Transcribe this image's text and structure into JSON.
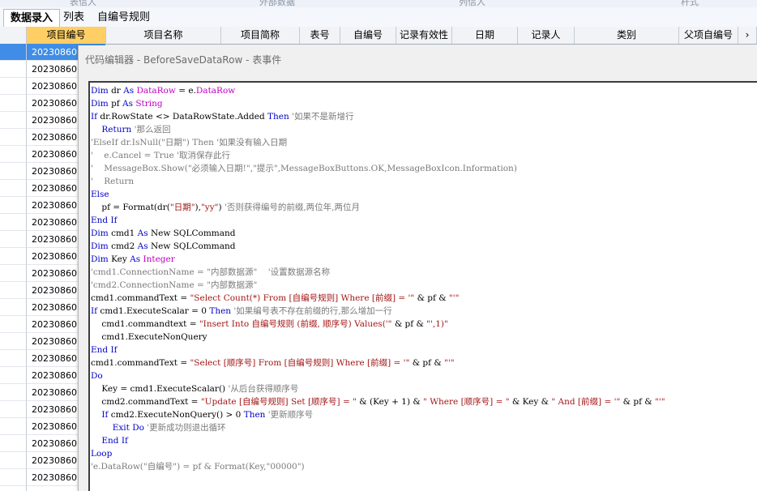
{
  "tabs": [
    {
      "label": "数据录入",
      "active": true
    },
    {
      "label": "列表",
      "active": false
    },
    {
      "label": "自编号规则",
      "active": false
    }
  ],
  "grid": {
    "columns": [
      "项目编号",
      "项目名称",
      "项目简称",
      "表号",
      "自编号",
      "记录有效性",
      "日期",
      "记录人",
      "类别",
      "父项自编号",
      "›"
    ],
    "selected_column": 0,
    "rows": [
      "20230860",
      "20230860",
      "20230860",
      "20230860",
      "20230860",
      "20230860",
      "20230860",
      "20230860",
      "20230860",
      "20230860",
      "20230860",
      "20230860",
      "20230860",
      "20230860",
      "20230860",
      "20230860",
      "20230860",
      "20230860",
      "20230860",
      "20230860",
      "20230860",
      "20230860",
      "20230860",
      "20230860",
      "20230860",
      "20230860",
      "20230860"
    ],
    "current_row": 0
  },
  "editor": {
    "title": "代码编辑器 - BeforeSaveDataRow - 表事件",
    "lines": [
      [
        [
          "kw",
          "Dim"
        ],
        [
          "t",
          " dr "
        ],
        [
          "kw",
          "As"
        ],
        [
          "t",
          " "
        ],
        [
          "cls",
          "DataRow"
        ],
        [
          "t",
          " = e."
        ],
        [
          "cls",
          "DataRow"
        ]
      ],
      [
        [
          "kw",
          "Dim"
        ],
        [
          "t",
          " pf "
        ],
        [
          "kw",
          "As"
        ],
        [
          "t",
          " "
        ],
        [
          "cls",
          "String"
        ]
      ],
      [
        [
          "kw",
          "If"
        ],
        [
          "t",
          " dr.RowState <> DataRowState.Added "
        ],
        [
          "kw",
          "Then"
        ],
        [
          "cm",
          " '如果不是新增行"
        ]
      ],
      [
        [
          "t",
          "    "
        ],
        [
          "kw",
          "Return"
        ],
        [
          "cm",
          " '那么返回"
        ]
      ],
      [
        [
          "cm",
          "'ElseIf dr.IsNull(\"日期\") Then '如果没有输入日期"
        ]
      ],
      [
        [
          "cm",
          "'    e.Cancel = True '取消保存此行"
        ]
      ],
      [
        [
          "cm",
          "'    MessageBox.Show(\"必须输入日期!\",\"提示\",MessageBoxButtons.OK,MessageBoxIcon.Information)"
        ]
      ],
      [
        [
          "cm",
          "'    Return"
        ]
      ],
      [
        [
          "kw",
          "Else"
        ]
      ],
      [
        [
          "t",
          "    pf = Format(dr("
        ],
        [
          "str",
          "\"日期\""
        ],
        [
          "t",
          "),"
        ],
        [
          "str",
          "\"yy\""
        ],
        [
          "t",
          ") "
        ],
        [
          "cm",
          "'否则获得编号的前缀,两位年,两位月"
        ]
      ],
      [
        [
          "kw",
          "End If"
        ]
      ],
      [
        [
          "kw",
          "Dim"
        ],
        [
          "t",
          " cmd1 "
        ],
        [
          "kw",
          "As"
        ],
        [
          "t",
          " New SQLCommand"
        ]
      ],
      [
        [
          "kw",
          "Dim"
        ],
        [
          "t",
          " cmd2 "
        ],
        [
          "kw",
          "As"
        ],
        [
          "t",
          " New SQLCommand"
        ]
      ],
      [
        [
          "kw",
          "Dim"
        ],
        [
          "t",
          " Key "
        ],
        [
          "kw",
          "As"
        ],
        [
          "t",
          " "
        ],
        [
          "cls",
          "Integer"
        ]
      ],
      [
        [
          "cm",
          "'cmd1.ConnectionName = \"内部数据源\"    '设置数据源名称"
        ]
      ],
      [
        [
          "cm",
          "'cmd2.ConnectionName = \"内部数据源\""
        ]
      ],
      [
        [
          "t",
          "cmd1.commandText = "
        ],
        [
          "str",
          "\"Select Count(*) From [自编号规则] Where [前缀] = '\""
        ],
        [
          "t",
          " & pf & "
        ],
        [
          "str",
          "\"'\""
        ]
      ],
      [
        [
          "kw",
          "If"
        ],
        [
          "t",
          " cmd1.ExecuteScalar = 0 "
        ],
        [
          "kw",
          "Then"
        ],
        [
          "cm",
          " '如果编号表不存在前缀的行,那么增加一行"
        ]
      ],
      [
        [
          "t",
          "    cmd1.commandtext = "
        ],
        [
          "str",
          "\"Insert Into 自编号规则 (前缀, 顺序号) Values('\""
        ],
        [
          "t",
          " & pf & "
        ],
        [
          "str",
          "\"',1)\""
        ]
      ],
      [
        [
          "t",
          "    cmd1.ExecuteNonQuery"
        ]
      ],
      [
        [
          "kw",
          "End If"
        ]
      ],
      [
        [
          "t",
          "cmd1.commandText = "
        ],
        [
          "str",
          "\"Select [顺序号] From [自编号规则] Where [前缀] = '\""
        ],
        [
          "t",
          " & pf & "
        ],
        [
          "str",
          "\"'\""
        ]
      ],
      [
        [
          "kw",
          "Do"
        ]
      ],
      [
        [
          "t",
          "    Key = cmd1.ExecuteScalar() "
        ],
        [
          "cm",
          "'从后台获得顺序号"
        ]
      ],
      [
        [
          "t",
          "    cmd2.commandText = "
        ],
        [
          "str",
          "\"Update [自编号规则] Set [顺序号] = \""
        ],
        [
          "t",
          " & (Key + 1) & "
        ],
        [
          "str",
          "\" Where [顺序号] = \""
        ],
        [
          "t",
          " & Key & "
        ],
        [
          "str",
          "\" And [前缀] = '\""
        ],
        [
          "t",
          " & pf & "
        ],
        [
          "str",
          "\"'\""
        ]
      ],
      [
        [
          "t",
          "    "
        ],
        [
          "kw",
          "If"
        ],
        [
          "t",
          " cmd2.ExecuteNonQuery() > 0 "
        ],
        [
          "kw",
          "Then"
        ],
        [
          "cm",
          " '更新顺序号"
        ]
      ],
      [
        [
          "t",
          "        "
        ],
        [
          "kw",
          "Exit Do"
        ],
        [
          "cm",
          " '更新成功则退出循环"
        ]
      ],
      [
        [
          "t",
          "    "
        ],
        [
          "kw",
          "End If"
        ]
      ],
      [
        [
          "kw",
          "Loop"
        ]
      ],
      [
        [
          "cm",
          "'e.DataRow(\"自编号\") = pf & Format(Key,\"00000\")"
        ]
      ]
    ]
  }
}
